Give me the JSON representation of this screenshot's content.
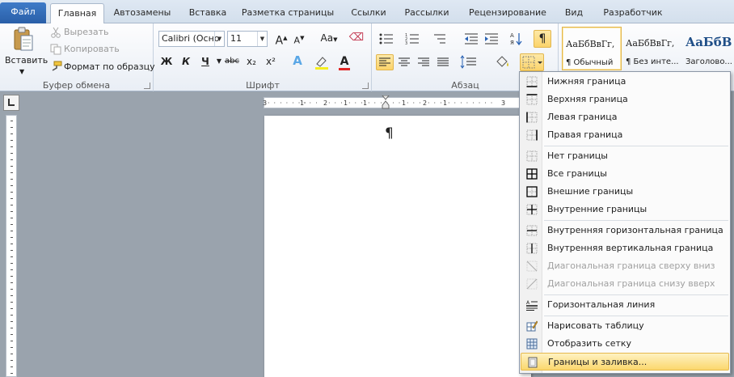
{
  "tabs": [
    "Файл",
    "Главная",
    "Автозамены",
    "Вставка",
    "Разметка страницы",
    "Ссылки",
    "Рассылки",
    "Рецензирование",
    "Вид",
    "Разработчик"
  ],
  "clipboard": {
    "paste": "Вставить",
    "cut": "Вырезать",
    "copy": "Копировать",
    "format_painter": "Формат по образцу",
    "label": "Буфер обмена"
  },
  "font": {
    "family": "Calibri (Осно",
    "size": "11",
    "label": "Шрифт",
    "bold": "Ж",
    "italic": "К",
    "underline": "Ч",
    "strike": "abc",
    "sub": "x₂",
    "sup": "x²",
    "grow": "A",
    "shrink": "A",
    "case": "Aa",
    "effects": "A",
    "color": "A"
  },
  "paragraph": {
    "label": "Абзац",
    "pilcrow": "¶"
  },
  "styles": [
    {
      "sample": "АаБбВвГг,",
      "name": "¶ Обычный"
    },
    {
      "sample": "АаБбВвГг,",
      "name": "¶ Без инте..."
    },
    {
      "sample": "АаБбВ",
      "name": "Заголово..."
    }
  ],
  "ruler": {
    "marks": [
      "3",
      "1",
      "2",
      "1",
      "1",
      "1",
      "2",
      "1",
      "3"
    ]
  },
  "document": {
    "pilcrow": "¶"
  },
  "menu": {
    "items": [
      {
        "label": "Нижняя граница",
        "icon": "border-bottom-icon",
        "disabled": false
      },
      {
        "label": "Верхняя граница",
        "icon": "border-top-icon",
        "disabled": false
      },
      {
        "label": "Левая граница",
        "icon": "border-left-icon",
        "disabled": false
      },
      {
        "label": "Правая граница",
        "icon": "border-right-icon",
        "disabled": false
      },
      {
        "label": "Нет границы",
        "icon": "no-border-icon",
        "disabled": false
      },
      {
        "label": "Все границы",
        "icon": "all-borders-icon",
        "disabled": false
      },
      {
        "label": "Внешние границы",
        "icon": "outside-borders-icon",
        "disabled": false
      },
      {
        "label": "Внутренние границы",
        "icon": "inside-borders-icon",
        "disabled": false
      },
      {
        "label": "Внутренняя горизонтальная граница",
        "icon": "inside-horizontal-border-icon",
        "disabled": false
      },
      {
        "label": "Внутренняя вертикальная граница",
        "icon": "inside-vertical-border-icon",
        "disabled": false
      },
      {
        "label": "Диагональная граница сверху вниз",
        "icon": "diagonal-down-border-icon",
        "disabled": true
      },
      {
        "label": "Диагональная граница снизу вверх",
        "icon": "diagonal-up-border-icon",
        "disabled": true
      },
      {
        "label": "Горизонтальная линия",
        "icon": "horizontal-line-icon",
        "disabled": false
      },
      {
        "label": "Нарисовать таблицу",
        "icon": "draw-table-icon",
        "disabled": false
      },
      {
        "label": "Отобразить сетку",
        "icon": "view-gridlines-icon",
        "disabled": false
      },
      {
        "label": "Границы и заливка...",
        "icon": "borders-shading-icon",
        "disabled": false
      }
    ]
  }
}
